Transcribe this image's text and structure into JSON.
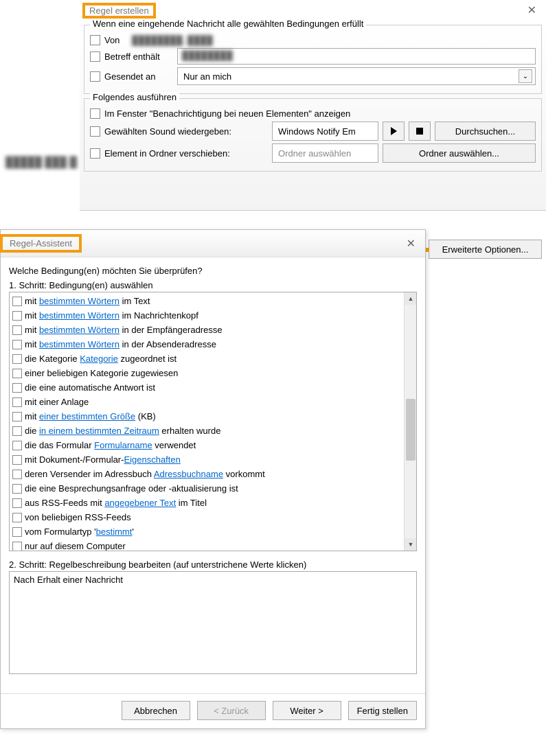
{
  "dlg1": {
    "title": "Regel erstellen",
    "group1_label": "Wenn eine eingehende Nachricht alle gewählten Bedingungen erfüllt",
    "from_label": "Von",
    "from_value": "████████, ████",
    "subject_label": "Betreff enthält",
    "subject_value": "████████",
    "sent_to_label": "Gesendet an",
    "sent_to_value": "Nur an mich",
    "group2_label": "Folgendes ausführen",
    "notify_label": "Im Fenster \"Benachrichtigung bei neuen Elementen\" anzeigen",
    "sound_label": "Gewählten Sound wiedergeben:",
    "sound_value": "Windows Notify Em",
    "browse_label": "Durchsuchen...",
    "move_label": "Element in Ordner verschieben:",
    "folder_placeholder": "Ordner auswählen",
    "folder_browse_label": "Ordner auswählen...",
    "advanced_label": "Erweiterte Optionen..."
  },
  "bg_blur_text": "█████ ███ █",
  "dlg2": {
    "title": "Regel-Assistent",
    "question": "Welche Bedingung(en) möchten Sie überprüfen?",
    "step1_label": "1. Schritt: Bedingung(en) auswählen",
    "step2_label": "2. Schritt: Regelbeschreibung bearbeiten (auf unterstrichene Werte klicken)",
    "desc_text": "Nach Erhalt einer Nachricht",
    "conditions": [
      {
        "pre": "mit ",
        "link": "bestimmten Wörtern",
        "post": " im Text"
      },
      {
        "pre": "mit ",
        "link": "bestimmten Wörtern",
        "post": " im Nachrichtenkopf"
      },
      {
        "pre": "mit ",
        "link": "bestimmten Wörtern",
        "post": " in der Empfängeradresse"
      },
      {
        "pre": "mit ",
        "link": "bestimmten Wörtern",
        "post": " in der Absenderadresse"
      },
      {
        "pre": "die Kategorie ",
        "link": "Kategorie",
        "post": " zugeordnet ist"
      },
      {
        "pre": "einer beliebigen Kategorie zugewiesen",
        "link": "",
        "post": ""
      },
      {
        "pre": "die eine automatische Antwort ist",
        "link": "",
        "post": ""
      },
      {
        "pre": "mit einer Anlage",
        "link": "",
        "post": ""
      },
      {
        "pre": "mit ",
        "link": "einer bestimmten Größe",
        "post": " (KB)"
      },
      {
        "pre": "die ",
        "link": "in einem bestimmten Zeitraum",
        "post": " erhalten wurde"
      },
      {
        "pre": "die das Formular ",
        "link": "Formularname",
        "post": " verwendet"
      },
      {
        "pre": "mit Dokument-/Formular-",
        "link": "Eigenschaften",
        "post": ""
      },
      {
        "pre": "deren Versender im Adressbuch ",
        "link": "Adressbuchname",
        "post": " vorkommt"
      },
      {
        "pre": "die eine Besprechungsanfrage oder -aktualisierung ist",
        "link": "",
        "post": ""
      },
      {
        "pre": "aus RSS-Feeds mit ",
        "link": "angegebener Text",
        "post": " im Titel"
      },
      {
        "pre": "von beliebigen RSS-Feeds",
        "link": "",
        "post": ""
      },
      {
        "pre": "vom Formulartyp '",
        "link": "bestimmt",
        "post": "'"
      },
      {
        "pre": "nur auf diesem Computer",
        "link": "",
        "post": ""
      }
    ],
    "btn_cancel": "Abbrechen",
    "btn_back": "< Zurück",
    "btn_next": "Weiter >",
    "btn_finish": "Fertig stellen"
  }
}
